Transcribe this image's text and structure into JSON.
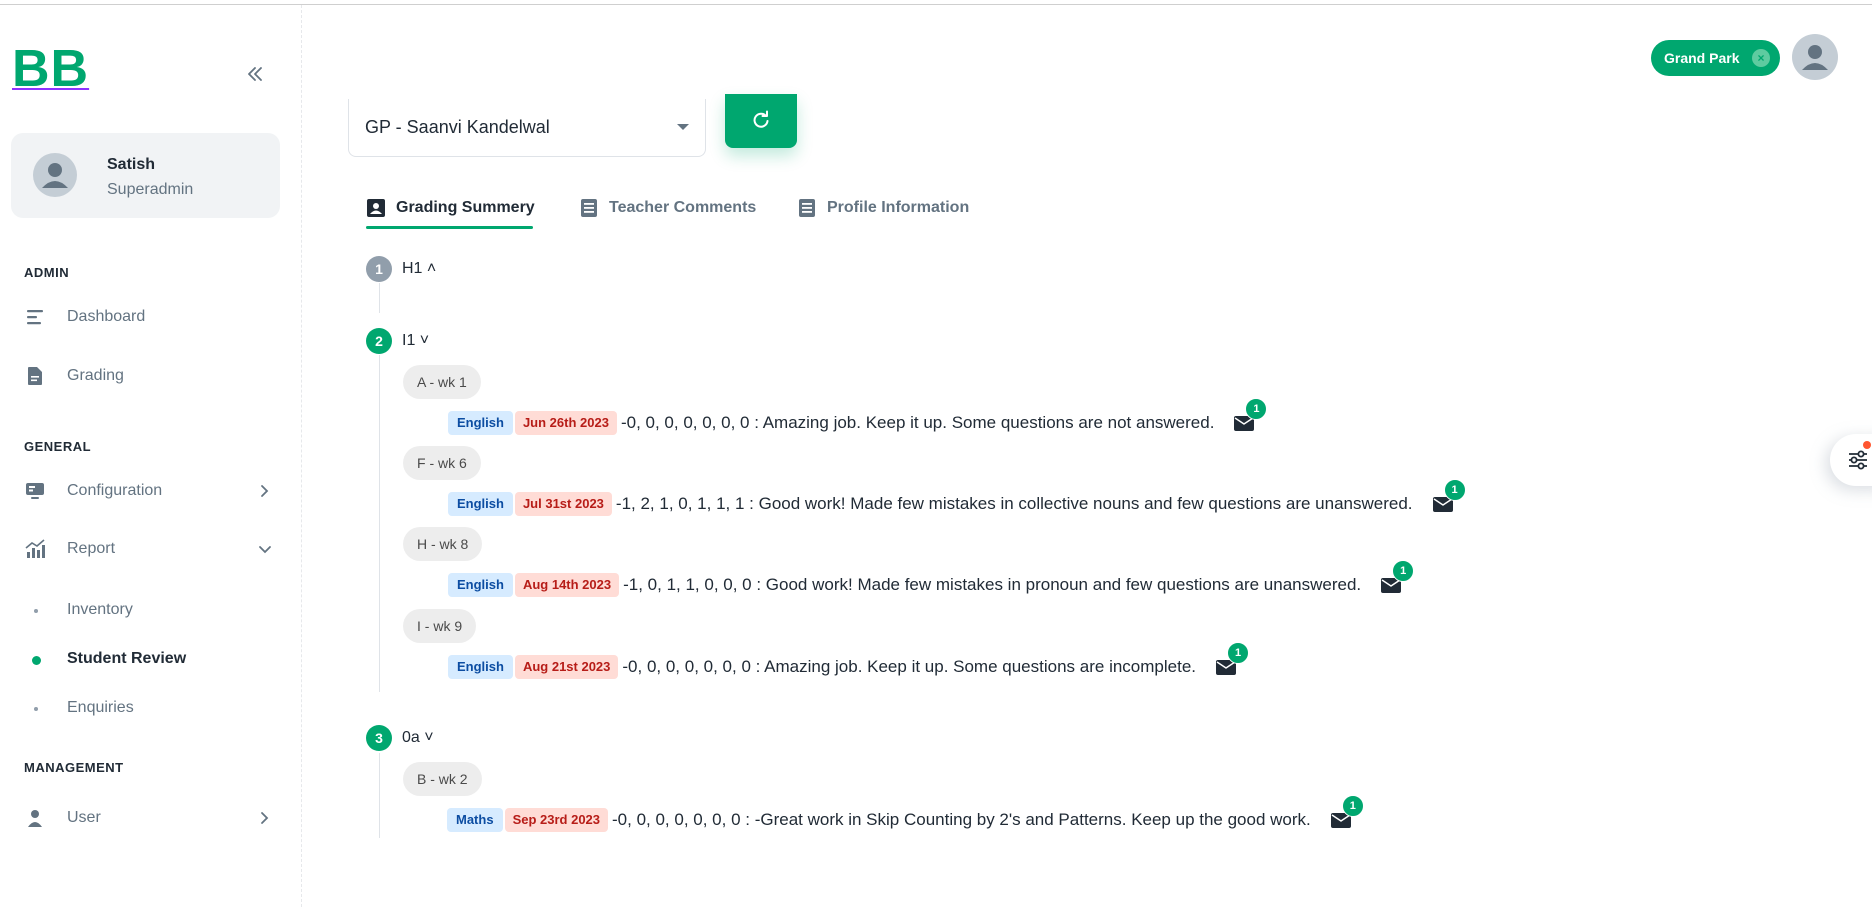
{
  "brand": {
    "logo_text": "BB",
    "color": "#00a76f"
  },
  "account": {
    "name": "Satish",
    "role": "Superadmin"
  },
  "sidebar": {
    "sections": [
      {
        "title": "ADMIN"
      },
      {
        "title": "GENERAL"
      },
      {
        "title": "MANAGEMENT"
      }
    ],
    "items": [
      {
        "label": "Dashboard",
        "icon": "dashboard-icon"
      },
      {
        "label": "Grading",
        "icon": "file-icon"
      },
      {
        "label": "Configuration",
        "icon": "monitor-icon"
      },
      {
        "label": "Report",
        "icon": "chart-icon"
      },
      {
        "label": "User",
        "icon": "user-icon"
      }
    ],
    "report_sub": [
      {
        "label": "Inventory",
        "active": false
      },
      {
        "label": "Student Review",
        "active": true
      },
      {
        "label": "Enquiries",
        "active": false
      }
    ]
  },
  "header": {
    "school_chip": "Grand Park",
    "chip_close": "×"
  },
  "student_select": {
    "value": "GP - Saanvi Kandelwal"
  },
  "tabs": [
    {
      "label": "Grading Summery",
      "active": true
    },
    {
      "label": "Teacher Comments",
      "active": false
    },
    {
      "label": "Profile Information",
      "active": false
    }
  ],
  "timeline": [
    {
      "num": "1",
      "label": "H1",
      "chevron": "˄",
      "color": "#919eab"
    },
    {
      "num": "2",
      "label": "I1",
      "chevron": "˅",
      "color": "#00a76f"
    },
    {
      "num": "3",
      "label": "0a",
      "chevron": "˅",
      "color": "#00a76f"
    }
  ],
  "entries": [
    {
      "week": "A - wk 1",
      "subject": "English",
      "date": "Jun 26th 2023",
      "text": "-0, 0, 0, 0, 0, 0, 0 : Amazing job. Keep it up. Some questions are not answered.",
      "count": "1"
    },
    {
      "week": "F - wk 6",
      "subject": "English",
      "date": "Jul 31st 2023",
      "text": "-1, 2, 1, 0, 1, 1, 1 : Good work! Made few mistakes in collective nouns and few questions are unanswered.",
      "count": "1"
    },
    {
      "week": "H - wk 8",
      "subject": "English",
      "date": "Aug 14th 2023",
      "text": "-1, 0, 1, 1, 0, 0, 0 : Good work! Made few mistakes in pronoun and few questions are unanswered.",
      "count": "1"
    },
    {
      "week": "I - wk 9",
      "subject": "English",
      "date": "Aug 21st 2023",
      "text": "-0, 0, 0, 0, 0, 0, 0 : Amazing job. Keep it up. Some questions are incomplete.",
      "count": "1"
    },
    {
      "week": "B - wk 2",
      "subject": "Maths",
      "date": "Sep 23rd 2023",
      "text": "-0, 0, 0, 0, 0, 0, 0 : -Great work in Skip Counting by 2's and Patterns. Keep up the good work.",
      "count": "1"
    }
  ]
}
